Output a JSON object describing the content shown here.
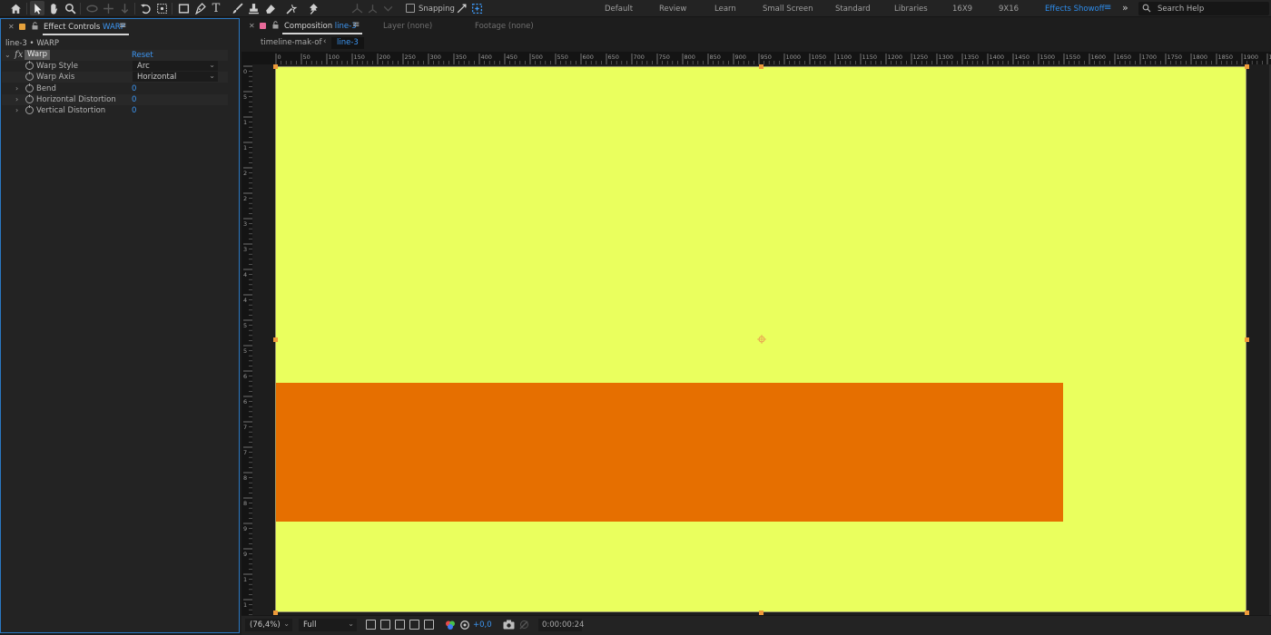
{
  "toolbar": {
    "snapping_label": "Snapping",
    "workspaces": [
      "Default",
      "Review",
      "Learn",
      "Small Screen",
      "Standard",
      "Libraries",
      "16X9",
      "9X16",
      "Effects Showoff"
    ],
    "active_workspace": "Effects Showoff",
    "menu_glyph": "≡",
    "more_glyph": "»",
    "search_placeholder": "Search Help"
  },
  "effect_controls": {
    "tab_prefix": "Effect Controls",
    "tab_layer": "WARP",
    "layer_path": "line-3 • WARP",
    "effect": {
      "name": "Warp",
      "reset_label": "Reset",
      "properties": [
        {
          "label": "Warp Style",
          "value": "Arc",
          "type": "dropdown"
        },
        {
          "label": "Warp Axis",
          "value": "Horizontal",
          "type": "dropdown"
        },
        {
          "label": "Bend",
          "value": "0",
          "type": "number"
        },
        {
          "label": "Horizontal Distortion",
          "value": "0",
          "type": "number"
        },
        {
          "label": "Vertical Distortion",
          "value": "0",
          "type": "number"
        }
      ]
    }
  },
  "composition": {
    "tab_prefix": "Composition",
    "tab_name": "line-3",
    "layer_tab": "Layer (none)",
    "footage_tab": "Footage (none)",
    "breadcrumbs": [
      "timeline-mak-of",
      "line-3"
    ],
    "ruler_labels": [
      "0",
      "50",
      "100",
      "150",
      "200",
      "250",
      "300",
      "350",
      "400",
      "450",
      "500",
      "550",
      "600",
      "650",
      "700",
      "750",
      "800",
      "850",
      "900",
      "950",
      "1000",
      "1050",
      "1100",
      "1150",
      "1200",
      "1250",
      "1300",
      "1350",
      "1400",
      "1450",
      "1500",
      "1550",
      "1600",
      "1650",
      "1700",
      "1750",
      "1800",
      "1850",
      "1900",
      "19"
    ],
    "ruler_left_labels": [
      "0",
      "5",
      "1",
      "1",
      "2",
      "2",
      "3",
      "3",
      "4",
      "4",
      "5",
      "5",
      "6",
      "6",
      "7",
      "7",
      "8",
      "8",
      "9",
      "9",
      "1",
      "1"
    ],
    "colors": {
      "background": "#eaff5e",
      "bar": "#e66f00",
      "handle": "#ee9a3a",
      "accent": "#3d96f2"
    },
    "zoom": "(76,4%)",
    "resolution": "Full",
    "exposure": "+0,0",
    "timecode": "0:00:00:24"
  }
}
